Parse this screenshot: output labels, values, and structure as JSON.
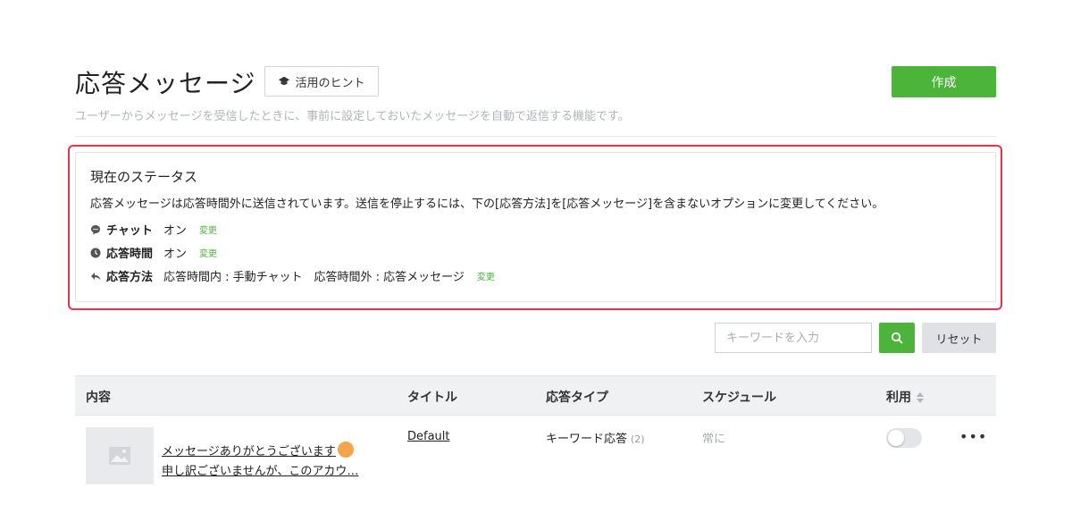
{
  "header": {
    "title": "応答メッセージ",
    "hint_button": "活用のヒント",
    "create_button": "作成",
    "subtitle": "ユーザーからメッセージを受信したときに、事前に設定しておいたメッセージを自動で返信する機能です。"
  },
  "status": {
    "heading": "現在のステータス",
    "description": "応答メッセージは応答時間外に送信されています。送信を停止するには、下の[応答方法]を[応答メッセージ]を含まないオプションに変更してください。",
    "rows": [
      {
        "icon": "chat-bubble-icon",
        "label": "チャット",
        "value": "オン",
        "link": "変更"
      },
      {
        "icon": "clock-icon",
        "label": "応答時間",
        "value": "オン",
        "link": "変更"
      },
      {
        "icon": "reply-icon",
        "label": "応答方法",
        "value": "応答時間内 : 手動チャット　応答時間外 : 応答メッセージ",
        "link": "変更"
      }
    ]
  },
  "search": {
    "placeholder": "キーワードを入力",
    "reset_label": "リセット"
  },
  "table": {
    "columns": [
      "内容",
      "タイトル",
      "応答タイプ",
      "スケジュール",
      "利用"
    ],
    "rows": [
      {
        "content_line1": "メッセージありがとうございます",
        "content_line2": "申し訳ございませんが、このアカウ…",
        "title": "Default",
        "type": "キーワード応答",
        "type_count": "(2)",
        "schedule": "常に",
        "enabled": false
      }
    ]
  },
  "colors": {
    "accent": "#4cb43a",
    "highlight_border": "#e8334f"
  }
}
